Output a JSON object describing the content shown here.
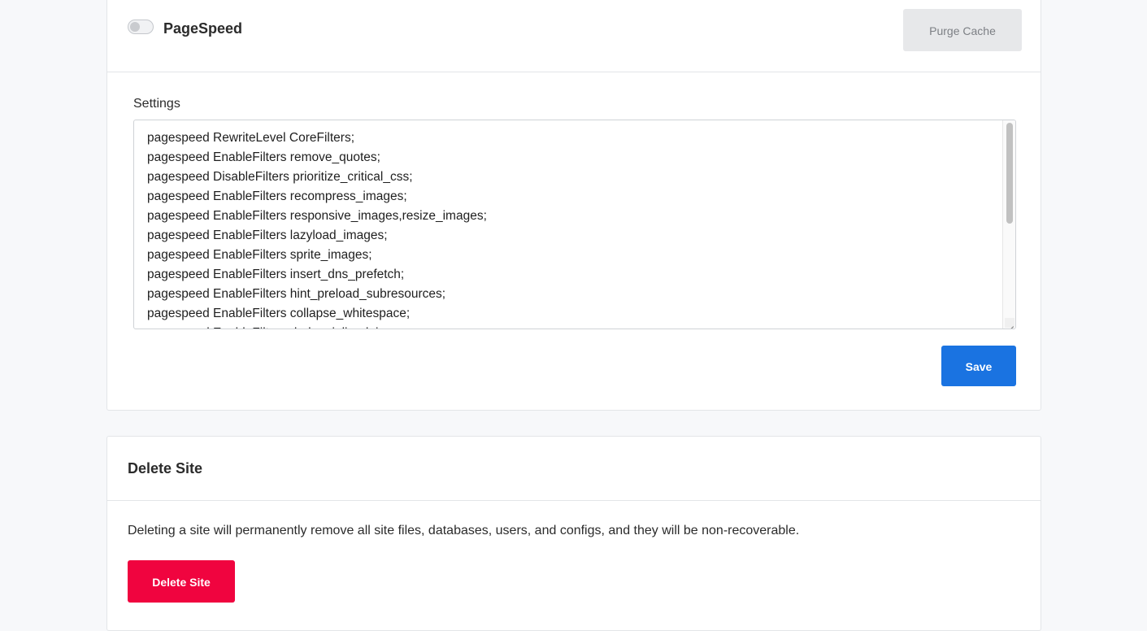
{
  "pagespeed": {
    "title": "PageSpeed",
    "toggle_enabled": false,
    "purge_label": "Purge Cache",
    "settings_label": "Settings",
    "settings_lines": [
      "pagespeed RewriteLevel CoreFilters;",
      "pagespeed EnableFilters remove_quotes;",
      "pagespeed DisableFilters prioritize_critical_css;",
      "pagespeed EnableFilters recompress_images;",
      "pagespeed EnableFilters responsive_images,resize_images;",
      "pagespeed EnableFilters lazyload_images;",
      "pagespeed EnableFilters sprite_images;",
      "pagespeed EnableFilters insert_dns_prefetch;",
      "pagespeed EnableFilters hint_preload_subresources;",
      "pagespeed EnableFilters collapse_whitespace;",
      "pagespeed EnableFilters dedup_inlined_images;"
    ],
    "save_label": "Save"
  },
  "delete_site": {
    "title": "Delete Site",
    "description": "Deleting a site will permanently remove all site files, databases, users, and configs, and they will be non-recoverable.",
    "button_label": "Delete Site"
  },
  "colors": {
    "primary": "#1a73e1",
    "danger": "#f0043f",
    "disabled_bg": "#e7e8ea"
  }
}
